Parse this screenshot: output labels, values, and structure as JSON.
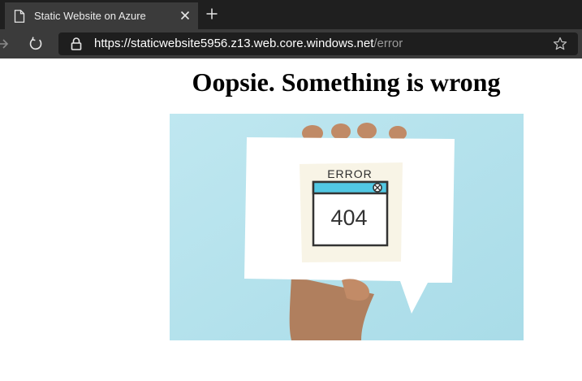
{
  "browser": {
    "tab": {
      "title": "Static Website on Azure"
    },
    "address": {
      "host": "https://staticwebsite5956.z13.web.core.windows.net",
      "path": "/error"
    }
  },
  "page": {
    "heading": "Oopsie. Something is wrong",
    "illustration": {
      "error_label": "ERROR",
      "code": "404"
    }
  },
  "colors": {
    "tabstrip": "#1f1f1f",
    "toolbar": "#3b3b3b",
    "omnibox": "#1e1e1e",
    "photo_bg": "#b5e3ec",
    "window_titlebar": "#52c8e3"
  },
  "icons": {
    "tab": "page-icon",
    "close": "close-icon",
    "new_tab": "plus-icon",
    "forward": "forward-arrow-icon",
    "refresh": "refresh-icon",
    "secure": "lock-icon",
    "favorite": "star-icon"
  }
}
